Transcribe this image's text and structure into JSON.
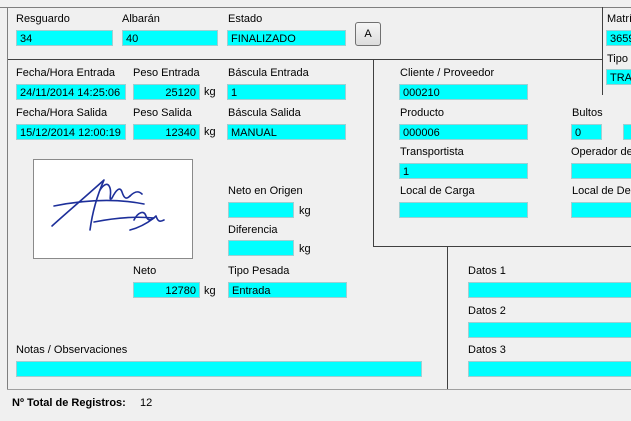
{
  "header": {
    "resguardo_label": "Resguardo",
    "resguardo_value": "34",
    "albaran_label": "Albarán",
    "albaran_value": "40",
    "estado_label": "Estado",
    "estado_value": "FINALIZADO",
    "a_button_label": "A",
    "matricula_label": "Matrí",
    "matricula_value": "3659",
    "tipo_label": "Tipo",
    "tipo_value": "TRA"
  },
  "weighing": {
    "entrada_datetime_label": "Fecha/Hora Entrada",
    "entrada_datetime_value": "24/11/2014 14:25:06",
    "peso_entrada_label": "Peso Entrada",
    "peso_entrada_value": "25120",
    "bascula_entrada_label": "Báscula Entrada",
    "bascula_entrada_value": "1",
    "salida_datetime_label": "Fecha/Hora Salida",
    "salida_datetime_value": "15/12/2014 12:00:19",
    "peso_salida_label": "Peso Salida",
    "peso_salida_value": "12340",
    "bascula_salida_label": "Báscula Salida",
    "bascula_salida_value": "MANUAL",
    "unit": "kg",
    "neto_origen_label": "Neto en Origen",
    "neto_origen_value": "",
    "diferencia_label": "Diferencia",
    "diferencia_value": "",
    "neto_label": "Neto",
    "neto_value": "12780",
    "tipo_pesada_label": "Tipo Pesada",
    "tipo_pesada_value": "Entrada"
  },
  "client": {
    "cliente_label": "Cliente / Proveedor",
    "cliente_value": "000210",
    "producto_label": "Producto",
    "producto_value": "000006",
    "bultos_label": "Bultos",
    "bultos_value": "0",
    "transportista_label": "Transportista",
    "transportista_value": "1",
    "operador_label": "Operador de",
    "local_carga_label": "Local de Carga",
    "local_carga_value": "",
    "local_descarga_label": "Local de Des"
  },
  "datos": {
    "datos1_label": "Datos 1",
    "datos2_label": "Datos 2",
    "datos3_label": "Datos 3"
  },
  "notes": {
    "label": "Notas / Observaciones",
    "value": ""
  },
  "statusbar": {
    "total_label": "Nº Total de Registros:",
    "total_value": "12"
  },
  "colors": {
    "field_bg": "#00ffff",
    "panel_bg": "#f0f0f0"
  }
}
